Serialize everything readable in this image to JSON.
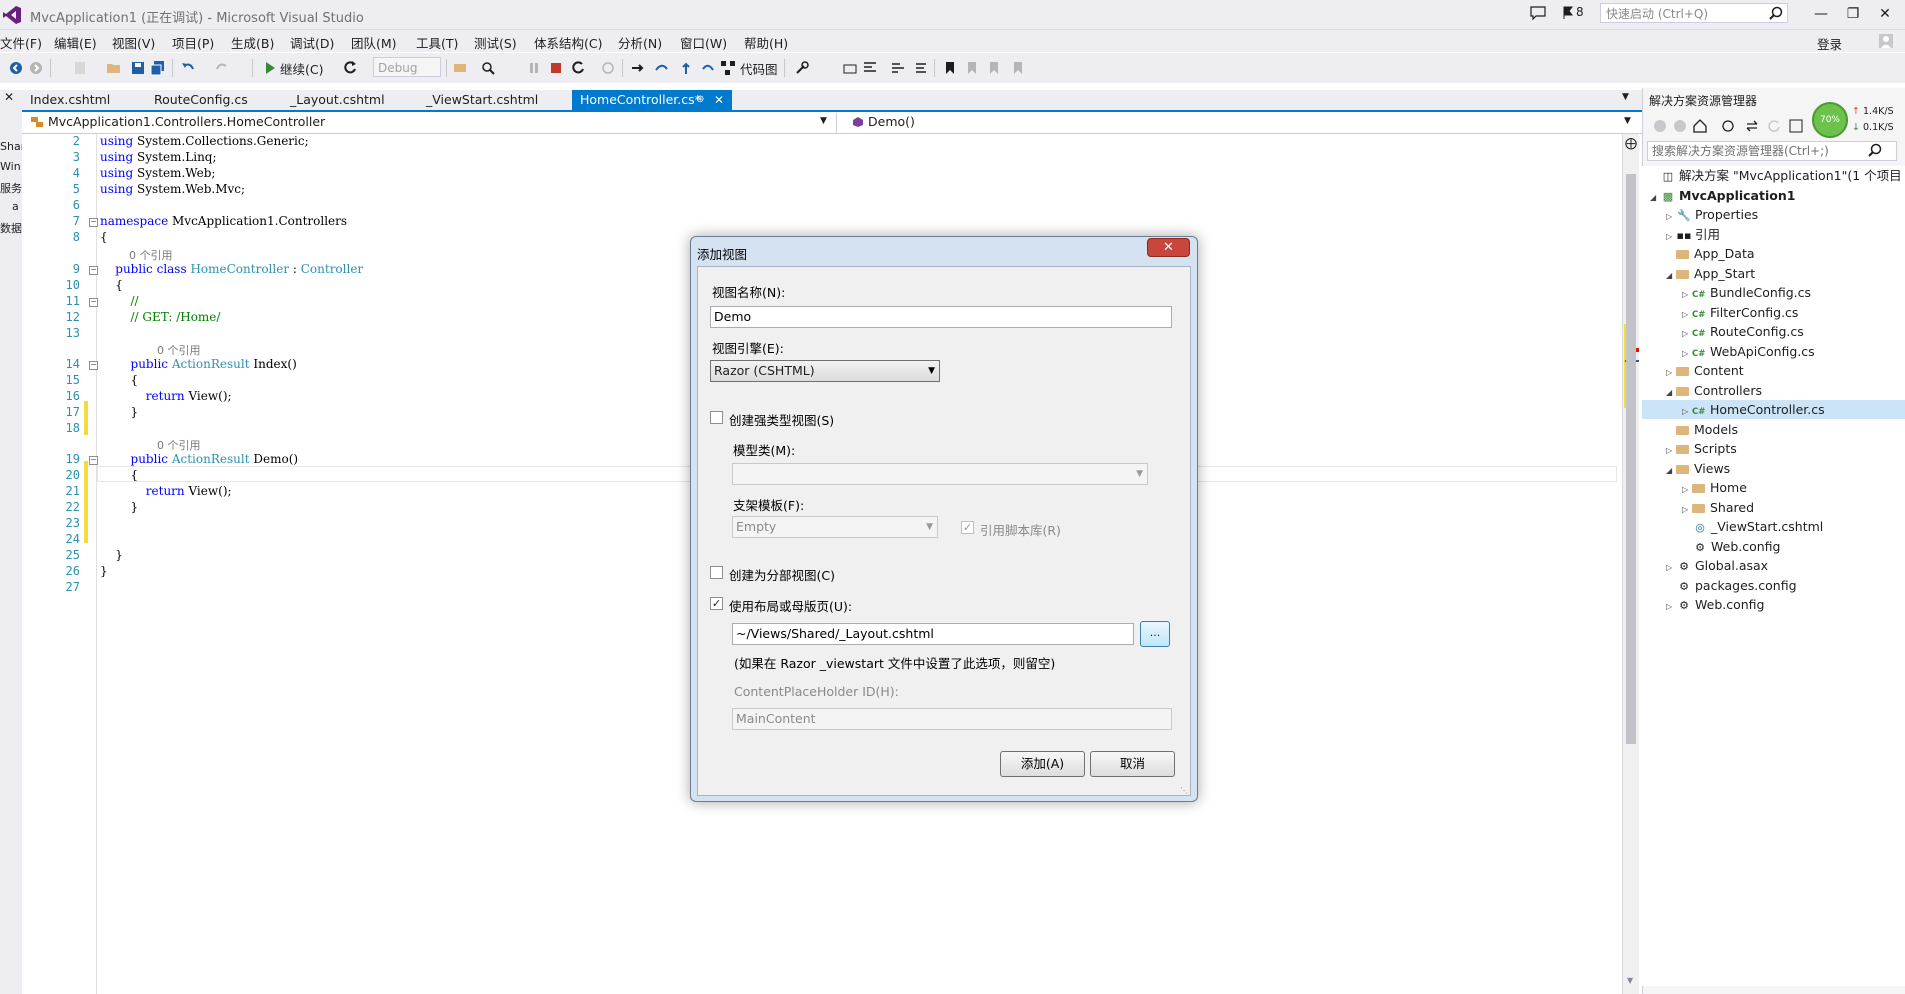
{
  "window": {
    "title": "MvcApplication1 (正在调试) - Microsoft Visual Studio",
    "notification_count": "8",
    "quick_launch_placeholder": "快速启动 (Ctrl+Q)",
    "login": "登录"
  },
  "menu": [
    "文件(F)",
    "编辑(E)",
    "视图(V)",
    "项目(P)",
    "生成(B)",
    "调试(D)",
    "团队(M)",
    "工具(T)",
    "测试(S)",
    "体系结构(C)",
    "分析(N)",
    "窗口(W)",
    "帮助(H)"
  ],
  "toolbar": {
    "continue_label": "继续(C)",
    "config": "Debug",
    "code_map_label": "代码图"
  },
  "left_strip": [
    "Shar",
    "Win",
    "服务",
    "a",
    "数据"
  ],
  "tabs": [
    "Index.cshtml",
    "RouteConfig.cs",
    "_Layout.cshtml",
    "_ViewStart.cshtml",
    "HomeController.cs*"
  ],
  "nav": {
    "left": "MvcApplication1.Controllers.HomeController",
    "right": "Demo()"
  },
  "code": {
    "ref_text": "0 个引用",
    "lines": [
      {
        "n": "2",
        "t": "using System.Collections.Generic;"
      },
      {
        "n": "3",
        "t": "using System.Linq;"
      },
      {
        "n": "4",
        "t": "using System.Web;"
      },
      {
        "n": "5",
        "t": "using System.Web.Mvc;"
      },
      {
        "n": "6",
        "t": ""
      },
      {
        "n": "7",
        "t": "namespace MvcApplication1.Controllers"
      },
      {
        "n": "8",
        "t": "{"
      },
      {
        "n": "9",
        "t": "    public class HomeController : Controller"
      },
      {
        "n": "10",
        "t": "    {"
      },
      {
        "n": "11",
        "t": "        //"
      },
      {
        "n": "12",
        "t": "        // GET: /Home/"
      },
      {
        "n": "13",
        "t": ""
      },
      {
        "n": "14",
        "t": "        public ActionResult Index()"
      },
      {
        "n": "15",
        "t": "        {"
      },
      {
        "n": "16",
        "t": "            return View();"
      },
      {
        "n": "17",
        "t": "        }"
      },
      {
        "n": "18",
        "t": ""
      },
      {
        "n": "19",
        "t": "        public ActionResult Demo()"
      },
      {
        "n": "20",
        "t": "        {"
      },
      {
        "n": "21",
        "t": "            return View();"
      },
      {
        "n": "22",
        "t": "        }"
      },
      {
        "n": "23",
        "t": ""
      },
      {
        "n": "24",
        "t": ""
      },
      {
        "n": "25",
        "t": "    }"
      },
      {
        "n": "26",
        "t": "}"
      },
      {
        "n": "27",
        "t": ""
      }
    ]
  },
  "dialog": {
    "title": "添加视图",
    "close": "✕",
    "view_name_label": "视图名称(N):",
    "view_name_value": "Demo",
    "engine_label": "视图引擎(E):",
    "engine_value": "Razor (CSHTML)",
    "strongly_typed_label": "创建强类型视图(S)",
    "strongly_typed_checked": false,
    "model_class_label": "模型类(M):",
    "model_class_value": "",
    "scaffold_label": "支架模板(F):",
    "scaffold_value": "Empty",
    "ref_scripts_label": "引用脚本库(R)",
    "ref_scripts_checked": true,
    "partial_label": "创建为分部视图(C)",
    "partial_checked": false,
    "layout_label": "使用布局或母版页(U):",
    "layout_checked": true,
    "layout_value": "~/Views/Shared/_Layout.cshtml",
    "browse_label": "...",
    "layout_hint": "(如果在 Razor _viewstart 文件中设置了此选项，则留空)",
    "placeholder_id_label": "ContentPlaceHolder ID(H):",
    "placeholder_id_value": "MainContent",
    "add_button": "添加(A)",
    "cancel_button": "取消"
  },
  "solution_explorer": {
    "title": "解决方案资源管理器",
    "search_placeholder": "搜索解决方案资源管理器(Ctrl+;)",
    "speed": {
      "percent": "70%",
      "up": "1.4K/S",
      "down": "0.1K/S"
    },
    "nodes": [
      {
        "label": "解决方案 \"MvcApplication1\"(1 个项目",
        "level": 0,
        "icon": "solution",
        "expander": ""
      },
      {
        "label": "MvcApplication1",
        "level": 0,
        "icon": "project",
        "expander": "open",
        "bold": true
      },
      {
        "label": "Properties",
        "level": 1,
        "icon": "properties",
        "expander": "closed"
      },
      {
        "label": "引用",
        "level": 1,
        "icon": "references",
        "expander": "closed"
      },
      {
        "label": "App_Data",
        "level": 1,
        "icon": "folder",
        "expander": ""
      },
      {
        "label": "App_Start",
        "level": 1,
        "icon": "folder",
        "expander": "open"
      },
      {
        "label": "BundleConfig.cs",
        "level": 2,
        "icon": "cs",
        "expander": "closed"
      },
      {
        "label": "FilterConfig.cs",
        "level": 2,
        "icon": "cs",
        "expander": "closed"
      },
      {
        "label": "RouteConfig.cs",
        "level": 2,
        "icon": "cs",
        "expander": "closed"
      },
      {
        "label": "WebApiConfig.cs",
        "level": 2,
        "icon": "cs",
        "expander": "closed"
      },
      {
        "label": "Content",
        "level": 1,
        "icon": "folder",
        "expander": "closed"
      },
      {
        "label": "Controllers",
        "level": 1,
        "icon": "folder",
        "expander": "open"
      },
      {
        "label": "HomeController.cs",
        "level": 2,
        "icon": "cs",
        "expander": "closed",
        "selected": true
      },
      {
        "label": "Models",
        "level": 1,
        "icon": "folder",
        "expander": ""
      },
      {
        "label": "Scripts",
        "level": 1,
        "icon": "folder",
        "expander": "closed"
      },
      {
        "label": "Views",
        "level": 1,
        "icon": "folder",
        "expander": "open"
      },
      {
        "label": "Home",
        "level": 2,
        "icon": "folder",
        "expander": "closed"
      },
      {
        "label": "Shared",
        "level": 2,
        "icon": "folder",
        "expander": "closed"
      },
      {
        "label": "_ViewStart.cshtml",
        "level": 2,
        "icon": "cshtml",
        "expander": ""
      },
      {
        "label": "Web.config",
        "level": 2,
        "icon": "config",
        "expander": ""
      },
      {
        "label": "Global.asax",
        "level": 1,
        "icon": "asax",
        "expander": "closed"
      },
      {
        "label": "packages.config",
        "level": 1,
        "icon": "config",
        "expander": ""
      },
      {
        "label": "Web.config",
        "level": 1,
        "icon": "config",
        "expander": "closed"
      }
    ]
  },
  "colors": {
    "accent": "#007acc",
    "chrome": "#eeeef2",
    "keyword": "#0000ff",
    "type": "#2b91af",
    "comment": "#008000"
  }
}
